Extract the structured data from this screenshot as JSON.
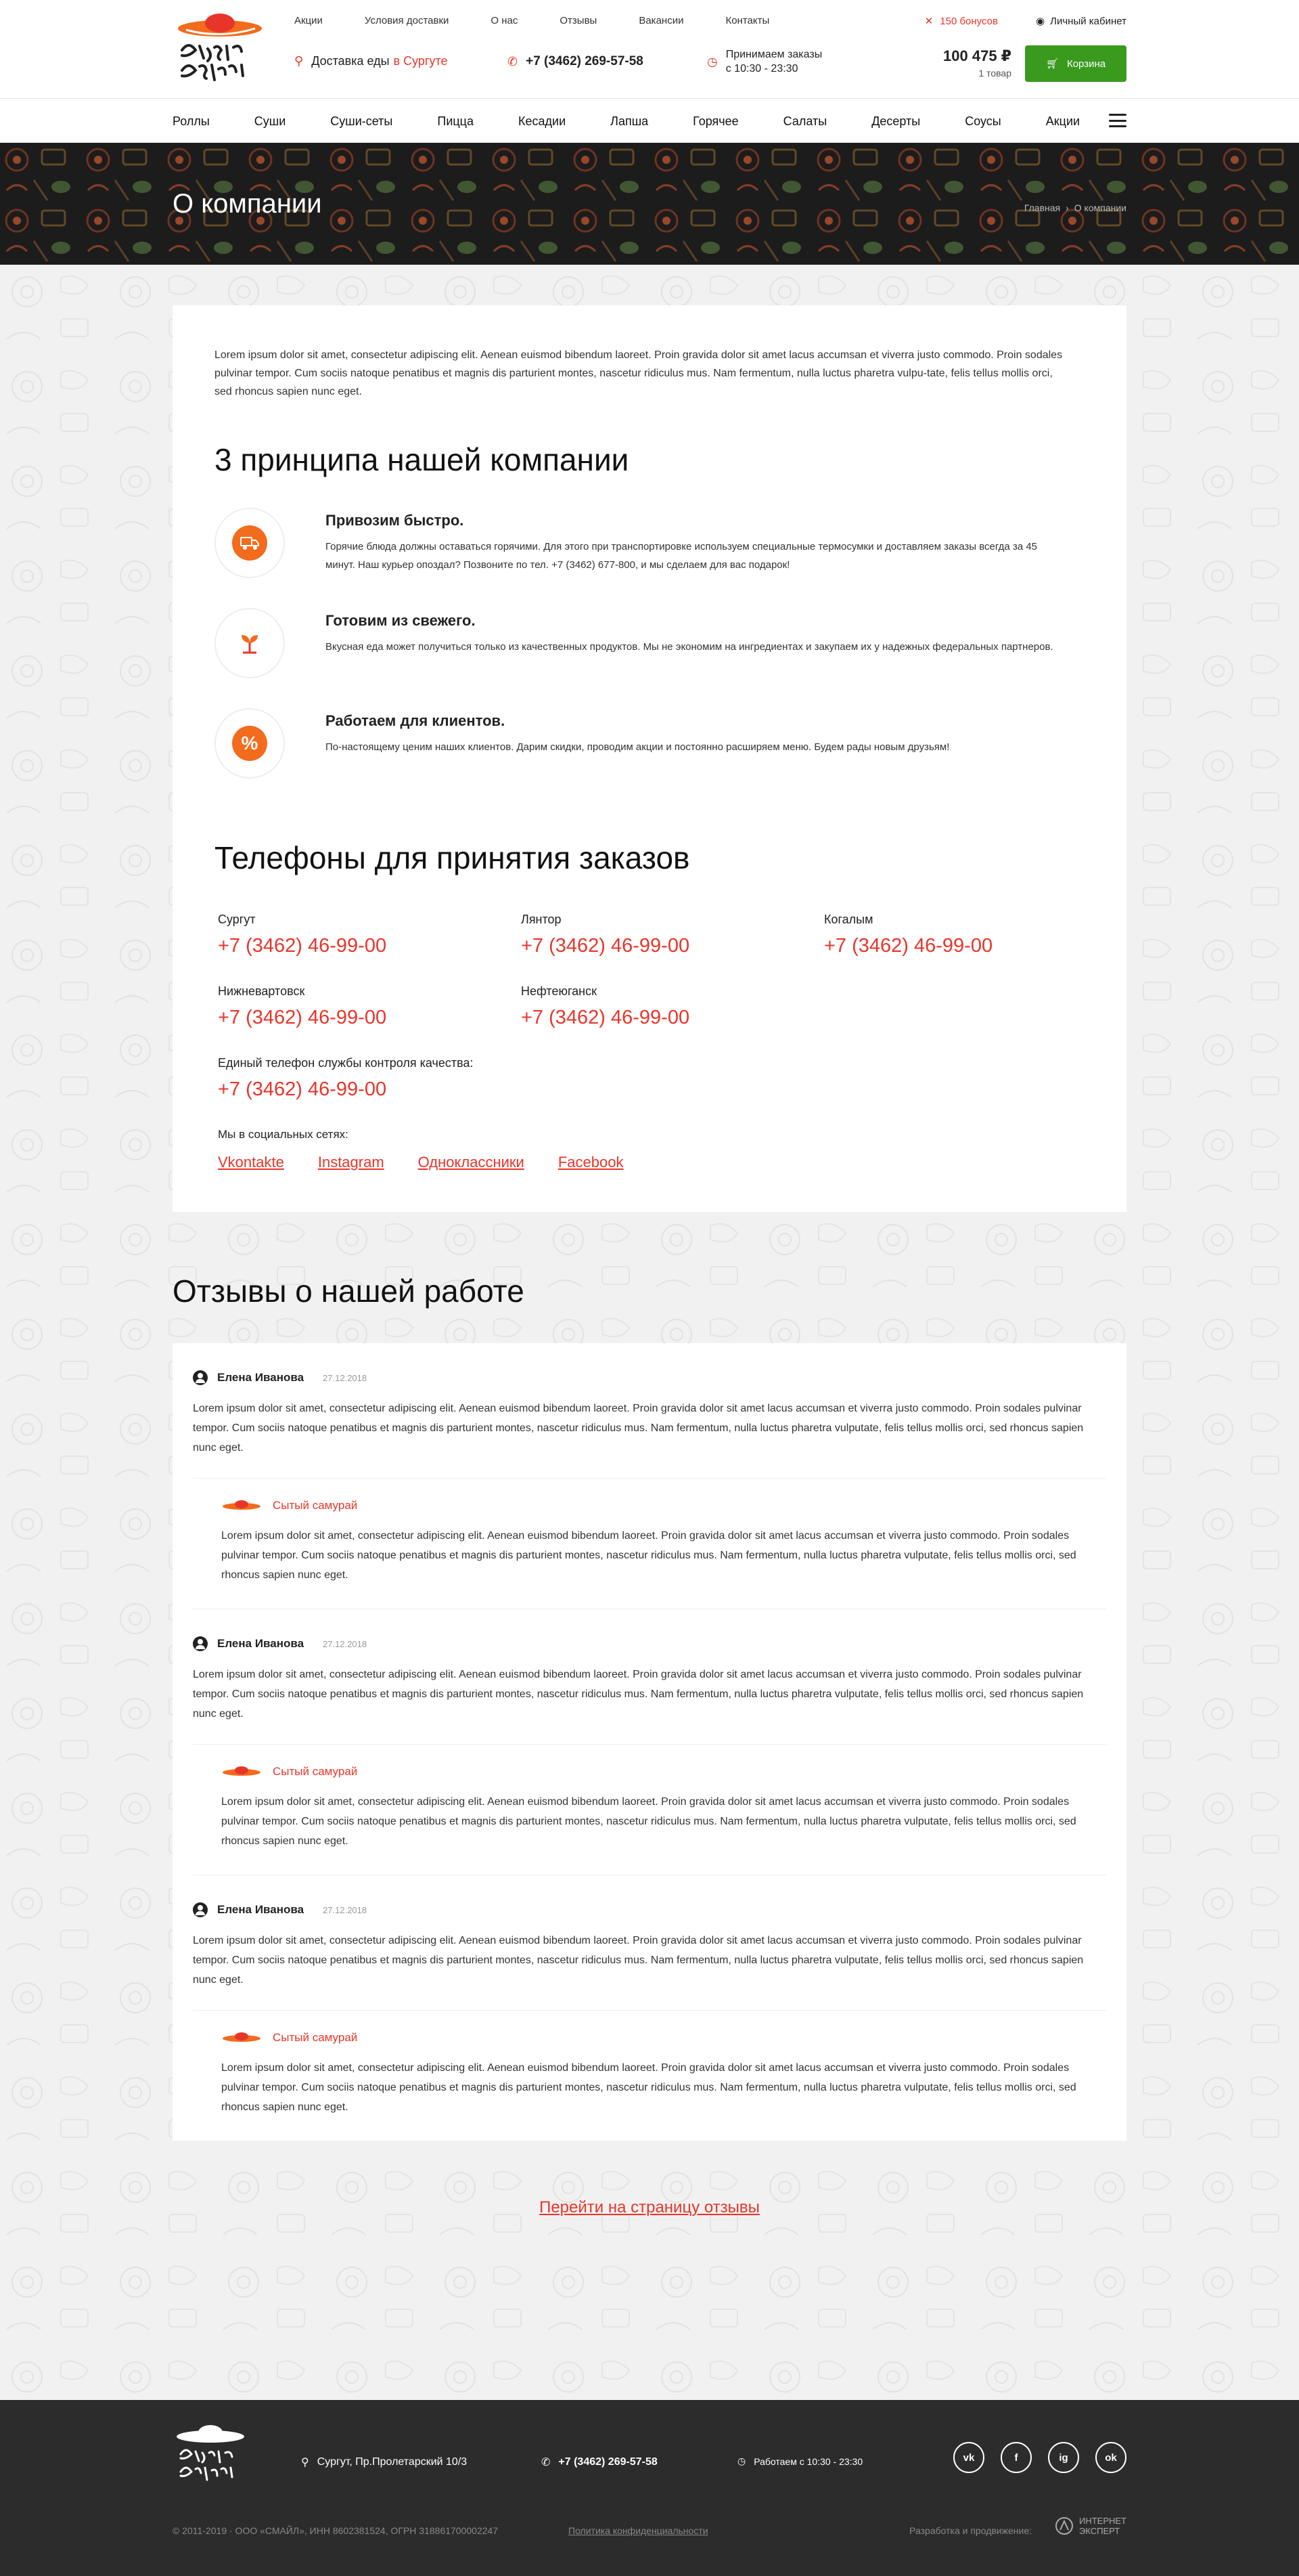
{
  "brand": {
    "name": "Сытый самурай",
    "logo_text": "Сытый Самурай"
  },
  "header": {
    "top_links": [
      "Акции",
      "Условия доставки",
      "О нас",
      "Отзывы",
      "Вакансии",
      "Контакты"
    ],
    "bonus": "150 бонусов",
    "cabinet": "Личный кабинет",
    "delivery_label": "Доставка еды",
    "delivery_city": "в Сургуте",
    "phone": "+7 (3462) 269-57-58",
    "hours_line1": "Принимаем заказы",
    "hours_line2": "с 10:30 - 23:30",
    "cart_sum": "100 475 ₽",
    "cart_count": "1 товар",
    "cart_button": "Корзина"
  },
  "menu": [
    "Роллы",
    "Суши",
    "Суши-сеты",
    "Пицца",
    "Кесадии",
    "Лапша",
    "Горячее",
    "Салаты",
    "Десерты",
    "Соусы",
    "Акции"
  ],
  "banner": {
    "title": "О компании",
    "crumb_home": "Главная",
    "crumb_sep": "›",
    "crumb_current": "О компании"
  },
  "about": {
    "intro": "Lorem ipsum dolor sit amet, consectetur adipiscing elit. Aenean euismod bibendum laoreet. Proin gravida dolor sit amet lacus accumsan et viverra justo commodo. Proin sodales pulvinar tempor. Cum sociis natoque penatibus et magnis dis parturient montes, nascetur ridiculus mus. Nam fermentum, nulla luctus pharetra vulpu-tate, felis tellus mollis orci, sed rhoncus sapien nunc eget.",
    "principles_title": "3 принципа нашей компании",
    "principles": [
      {
        "icon": "delivery-truck-icon",
        "title": "Привозим быстро.",
        "text": "Горячие блюда должны оставаться горячими. Для этого при транспортировке используем специальные термосумки и доставляем заказы всегда за 45 минут. Наш курьер опоздал? Позвоните по тел. +7 (3462) 677-800, и мы сделаем для вас подарок!"
      },
      {
        "icon": "sprout-icon",
        "title": "Готовим из свежего.",
        "text": "Вкусная еда может получиться только из качественных продуктов. Мы не экономим на ингредиентах и закупаем их у надежных федеральных партнеров."
      },
      {
        "icon": "percent-icon",
        "title": "Работаем для клиентов.",
        "text": "По-настоящему ценим наших клиентов. Дарим скидки, проводим акции и постоянно расширяем меню. Будем рады новым друзьям!"
      }
    ],
    "phones_title": "Телефоны для принятия заказов",
    "phones": [
      {
        "city": "Сургут",
        "phone": "+7 (3462) 46-99-00"
      },
      {
        "city": "Лянтор",
        "phone": "+7 (3462) 46-99-00"
      },
      {
        "city": "Когалым",
        "phone": "+7 (3462) 46-99-00"
      },
      {
        "city": "Нижневартовск",
        "phone": "+7 (3462) 46-99-00"
      },
      {
        "city": "Нефтеюганск",
        "phone": "+7 (3462) 46-99-00"
      }
    ],
    "quality_label": "Единый телефон службы контроля качества:",
    "quality_phone": "+7 (3462) 46-99-00",
    "social_title": "Мы в социальных сетях:",
    "socials": [
      "Vkontakte",
      "Instagram",
      "Одноклассники",
      "Facebook"
    ]
  },
  "reviews": {
    "title": "Отзывы о нашей работе",
    "items": [
      {
        "author": "Елена Иванова",
        "date": "27.12.2018",
        "text": "Lorem ipsum dolor sit amet, consectetur adipiscing elit. Aenean euismod bibendum laoreet. Proin gravida dolor sit amet lacus accumsan et viverra justo commodo. Proin sodales pulvinar tempor. Cum sociis natoque penatibus et magnis dis parturient montes, nascetur ridiculus mus. Nam fermentum, nulla luctus pharetra vulputate, felis tellus mollis orci, sed rhoncus sapien nunc eget.",
        "answer_author": "Сытый самурай",
        "answer_text": "Lorem ipsum dolor sit amet, consectetur adipiscing elit. Aenean euismod bibendum laoreet. Proin gravida dolor sit amet lacus accumsan et viverra justo commodo. Proin sodales pulvinar tempor. Cum sociis natoque penatibus et magnis dis parturient montes, nascetur ridiculus mus. Nam fermentum, nulla luctus pharetra vulputate, felis tellus mollis orci, sed rhoncus sapien nunc eget."
      },
      {
        "author": "Елена Иванова",
        "date": "27.12.2018",
        "text": "Lorem ipsum dolor sit amet, consectetur adipiscing elit. Aenean euismod bibendum laoreet. Proin gravida dolor sit amet lacus accumsan et viverra justo commodo. Proin sodales pulvinar tempor. Cum sociis natoque penatibus et magnis dis parturient montes, nascetur ridiculus mus. Nam fermentum, nulla luctus pharetra vulputate, felis tellus mollis orci, sed rhoncus sapien nunc eget.",
        "answer_author": "Сытый самурай",
        "answer_text": "Lorem ipsum dolor sit amet, consectetur adipiscing elit. Aenean euismod bibendum laoreet. Proin gravida dolor sit amet lacus accumsan et viverra justo commodo. Proin sodales pulvinar tempor. Cum sociis natoque penatibus et magnis dis parturient montes, nascetur ridiculus mus. Nam fermentum, nulla luctus pharetra vulputate, felis tellus mollis orci, sed rhoncus sapien nunc eget."
      },
      {
        "author": "Елена Иванова",
        "date": "27.12.2018",
        "text": "Lorem ipsum dolor sit amet, consectetur adipiscing elit. Aenean euismod bibendum laoreet. Proin gravida dolor sit amet lacus accumsan et viverra justo commodo. Proin sodales pulvinar tempor. Cum sociis natoque penatibus et magnis dis parturient montes, nascetur ridiculus mus. Nam fermentum, nulla luctus pharetra vulputate, felis tellus mollis orci, sed rhoncus sapien nunc eget.",
        "answer_author": "Сытый самурай",
        "answer_text": "Lorem ipsum dolor sit amet, consectetur adipiscing elit. Aenean euismod bibendum laoreet. Proin gravida dolor sit amet lacus accumsan et viverra justo commodo. Proin sodales pulvinar tempor. Cum sociis natoque penatibus et magnis dis parturient montes, nascetur ridiculus mus. Nam fermentum, nulla luctus pharetra vulputate, felis tellus mollis orci, sed rhoncus sapien nunc eget."
      }
    ],
    "more_link": "Перейти на страницу отзывы"
  },
  "footer": {
    "address": "Сургут, Пр.Пролетарский 10/3",
    "phone": "+7 (3462) 269-57-58",
    "hours": "Работаем с 10:30 - 23:30",
    "socials": [
      "vk",
      "f",
      "ig",
      "ok"
    ],
    "copyright": "© 2011-2019 · ООО «СМАЙЛ», ИНН 8602381524, ОГРН 318861700002247",
    "policy": "Политика конфиденциальности",
    "developer": "Разработка и продвижение:",
    "developer_name_1": "ИНТЕРНЕТ",
    "developer_name_2": "ЭКСПЕРТ"
  },
  "colors": {
    "accent": "#e8352a",
    "orange": "#f36b1c",
    "cart_green": "#3a9a1e",
    "footer_bg": "#2c2c2c",
    "banner_bg": "#1c1c1c"
  }
}
